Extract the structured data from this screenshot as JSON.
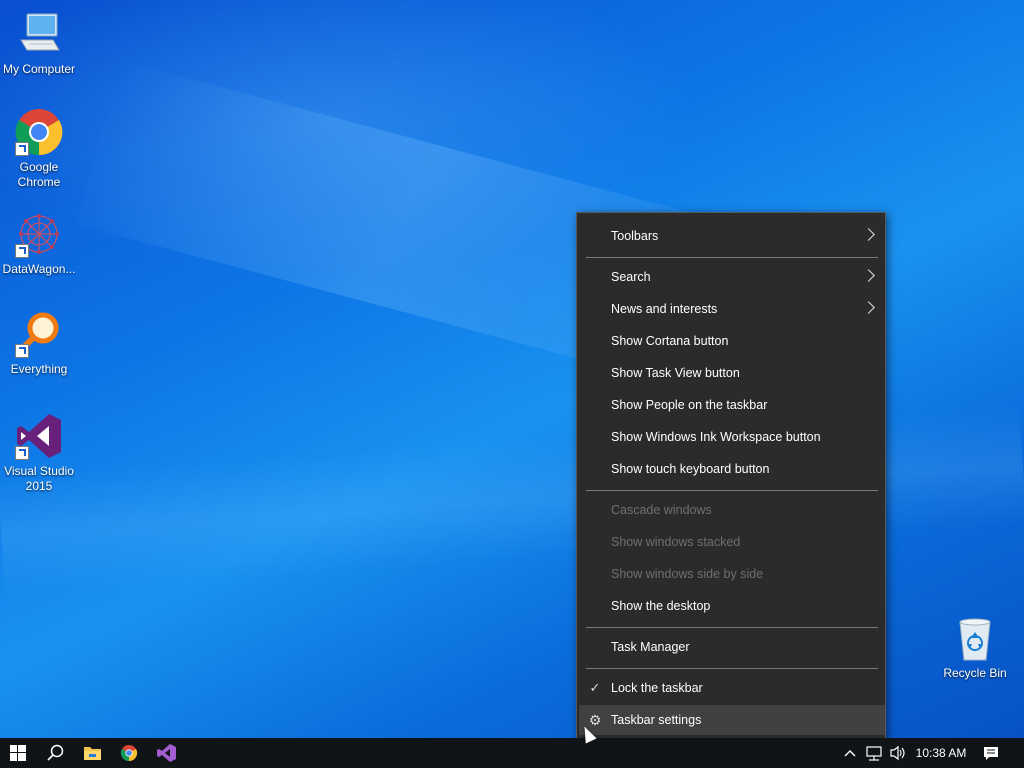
{
  "desktop": {
    "icons": [
      {
        "label": "My Computer"
      },
      {
        "label": "Google Chrome"
      },
      {
        "label": "DataWagon..."
      },
      {
        "label": "Everything"
      },
      {
        "label": "Visual Studio 2015"
      },
      {
        "label": "Recycle Bin"
      }
    ]
  },
  "context_menu": {
    "items": [
      {
        "label": "Toolbars",
        "state": "enabled",
        "submenu": true
      },
      {
        "label": "Search",
        "state": "enabled",
        "submenu": true
      },
      {
        "label": "News and interests",
        "state": "enabled",
        "submenu": true
      },
      {
        "label": "Show Cortana button",
        "state": "enabled"
      },
      {
        "label": "Show Task View button",
        "state": "enabled"
      },
      {
        "label": "Show People on the taskbar",
        "state": "enabled"
      },
      {
        "label": "Show Windows Ink Workspace button",
        "state": "enabled"
      },
      {
        "label": "Show touch keyboard button",
        "state": "enabled"
      },
      {
        "label": "Cascade windows",
        "state": "disabled"
      },
      {
        "label": "Show windows stacked",
        "state": "disabled"
      },
      {
        "label": "Show windows side by side",
        "state": "disabled"
      },
      {
        "label": "Show the desktop",
        "state": "enabled"
      },
      {
        "label": "Task Manager",
        "state": "enabled"
      },
      {
        "label": "Lock the taskbar",
        "state": "enabled",
        "checked": true
      },
      {
        "label": "Taskbar settings",
        "state": "highlighted",
        "icon": "gear-icon"
      }
    ]
  },
  "taskbar": {
    "clock": "10:38 AM"
  },
  "colors": {
    "menu_bg": "#2b2b2b",
    "menu_hover": "#414141",
    "menu_disabled_text": "#6f6f6f",
    "taskbar_bg": "#101417"
  }
}
